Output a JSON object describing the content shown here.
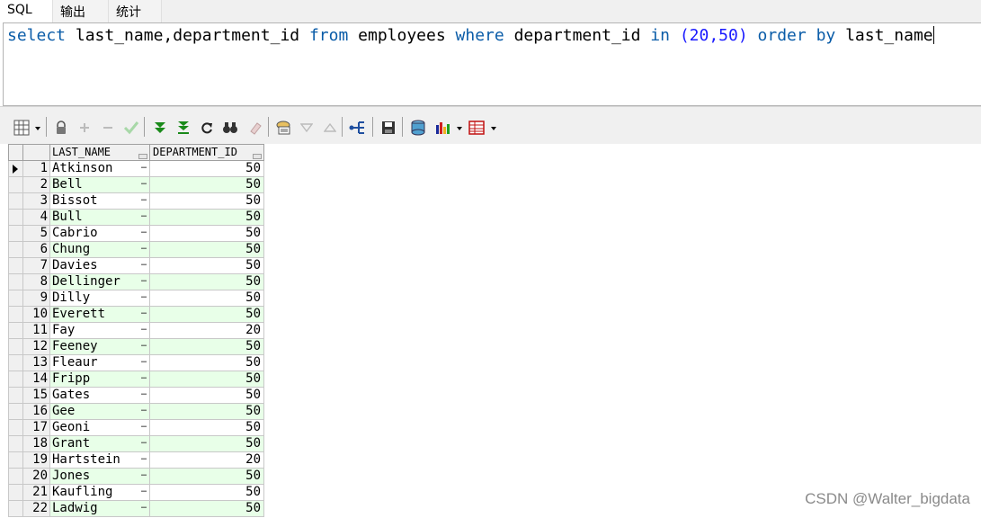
{
  "tabs": [
    {
      "label": "SQL",
      "active": true
    },
    {
      "label": "输出",
      "active": false
    },
    {
      "label": "统计",
      "active": false
    }
  ],
  "editor": {
    "sql_tokens": {
      "kw_select": "select",
      "fields": " last_name,department_id ",
      "kw_from": "from",
      "table": " employees ",
      "kw_where": "where",
      "col": " department_id ",
      "kw_in": "in",
      "values": " (20,50) ",
      "kw_order": "order",
      "kw_by": "by",
      "order_col": " last_name"
    }
  },
  "toolbar": {
    "icons": [
      "grid-view-icon",
      "lock-icon",
      "add-record-icon",
      "delete-record-icon",
      "post-changes-icon",
      "fetch-next-icon",
      "fetch-last-icon",
      "refresh-icon",
      "find-icon",
      "clear-icon",
      "query-by-example-icon",
      "filter-icon",
      "sort-icon",
      "explain-plan-icon",
      "save-icon",
      "export-icon",
      "chart-icon",
      "grid-options-icon"
    ]
  },
  "grid": {
    "columns": [
      "LAST_NAME",
      "DEPARTMENT_ID"
    ],
    "ellipsis": "…",
    "rows": [
      {
        "n": "1",
        "last_name": "Atkinson",
        "dept": "50"
      },
      {
        "n": "2",
        "last_name": "Bell",
        "dept": "50"
      },
      {
        "n": "3",
        "last_name": "Bissot",
        "dept": "50"
      },
      {
        "n": "4",
        "last_name": "Bull",
        "dept": "50"
      },
      {
        "n": "5",
        "last_name": "Cabrio",
        "dept": "50"
      },
      {
        "n": "6",
        "last_name": "Chung",
        "dept": "50"
      },
      {
        "n": "7",
        "last_name": "Davies",
        "dept": "50"
      },
      {
        "n": "8",
        "last_name": "Dellinger",
        "dept": "50"
      },
      {
        "n": "9",
        "last_name": "Dilly",
        "dept": "50"
      },
      {
        "n": "10",
        "last_name": "Everett",
        "dept": "50"
      },
      {
        "n": "11",
        "last_name": "Fay",
        "dept": "20"
      },
      {
        "n": "12",
        "last_name": "Feeney",
        "dept": "50"
      },
      {
        "n": "13",
        "last_name": "Fleaur",
        "dept": "50"
      },
      {
        "n": "14",
        "last_name": "Fripp",
        "dept": "50"
      },
      {
        "n": "15",
        "last_name": "Gates",
        "dept": "50"
      },
      {
        "n": "16",
        "last_name": "Gee",
        "dept": "50"
      },
      {
        "n": "17",
        "last_name": "Geoni",
        "dept": "50"
      },
      {
        "n": "18",
        "last_name": "Grant",
        "dept": "50"
      },
      {
        "n": "19",
        "last_name": "Hartstein",
        "dept": "20"
      },
      {
        "n": "20",
        "last_name": "Jones",
        "dept": "50"
      },
      {
        "n": "21",
        "last_name": "Kaufling",
        "dept": "50"
      },
      {
        "n": "22",
        "last_name": "Ladwig",
        "dept": "50"
      }
    ]
  },
  "watermark": "CSDN @Walter_bigdata",
  "colors": {
    "keyword": "#0a5ca8",
    "number": "#1a1aff",
    "alt_row": "#e8ffe8"
  }
}
